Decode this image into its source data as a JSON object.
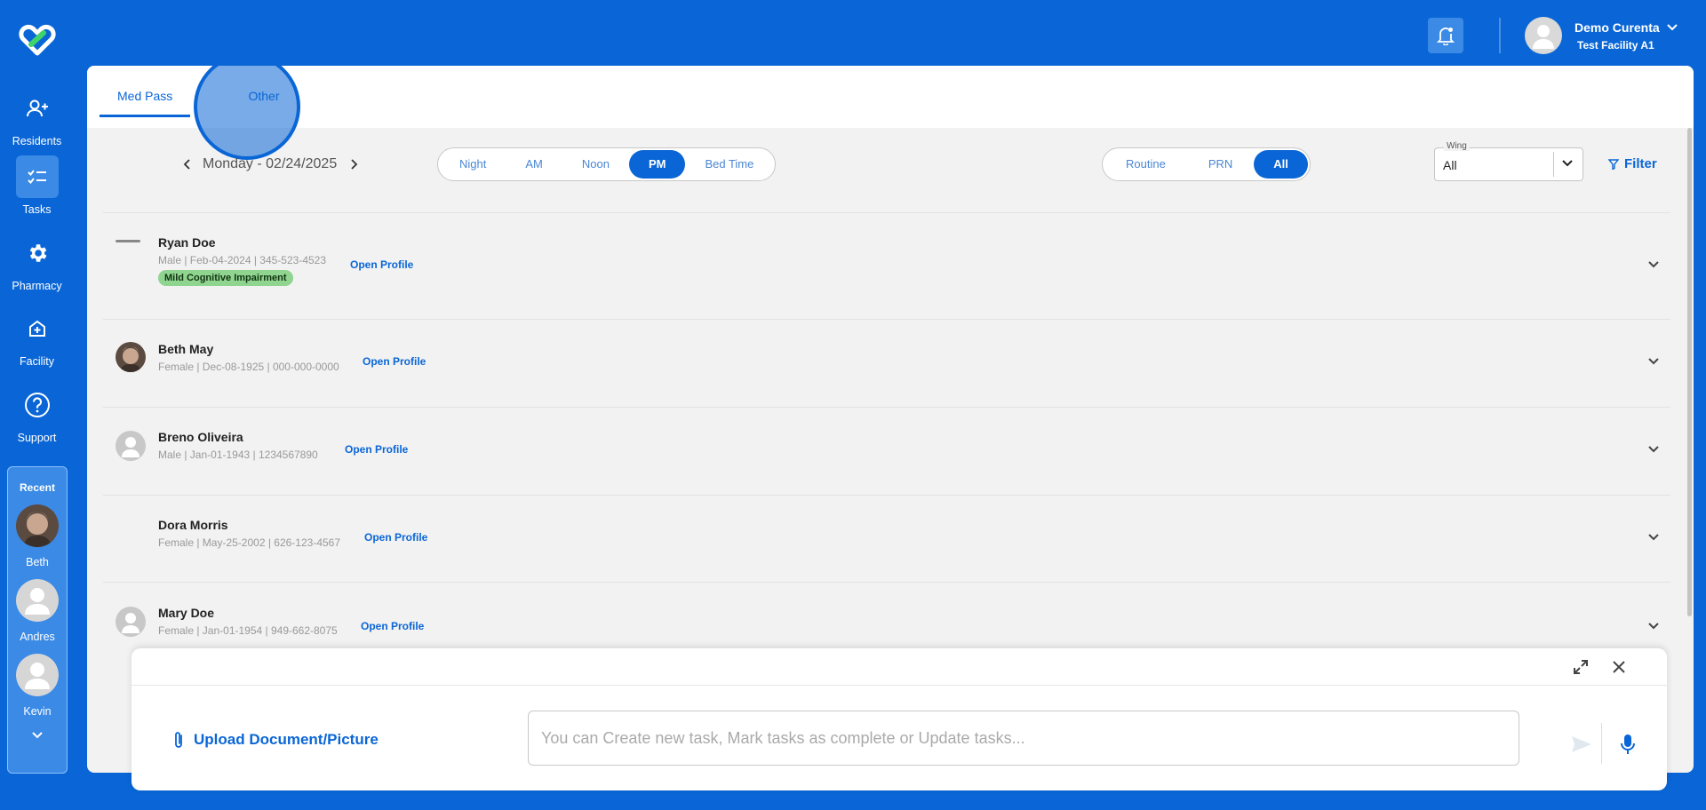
{
  "sidebar": {
    "items": [
      {
        "label": "Residents",
        "icon": "residents-icon"
      },
      {
        "label": "Tasks",
        "icon": "tasks-icon"
      },
      {
        "label": "Pharmacy",
        "icon": "gear-icon"
      },
      {
        "label": "Facility",
        "icon": "facility-icon"
      },
      {
        "label": "Support",
        "icon": "help-icon"
      }
    ],
    "recent": {
      "title": "Recent",
      "people": [
        {
          "name": "Beth"
        },
        {
          "name": "Andres"
        },
        {
          "name": "Kevin"
        }
      ]
    }
  },
  "header": {
    "user_name": "Demo Curenta",
    "facility": "Test Facility A1"
  },
  "tabs": [
    {
      "label": "Med Pass"
    },
    {
      "label": "Other"
    }
  ],
  "date_nav": {
    "date": "Monday - 02/24/2025"
  },
  "times": [
    {
      "label": "Night",
      "selected": false
    },
    {
      "label": "AM",
      "selected": false
    },
    {
      "label": "Noon",
      "selected": false
    },
    {
      "label": "PM",
      "selected": true
    },
    {
      "label": "Bed Time",
      "selected": false
    }
  ],
  "types": [
    {
      "label": "Routine",
      "selected": false
    },
    {
      "label": "PRN",
      "selected": false
    },
    {
      "label": "All",
      "selected": true
    }
  ],
  "wing": {
    "label": "Wing",
    "value": "All"
  },
  "filter_label": "Filter",
  "open_profile_label": "Open Profile",
  "residents": [
    {
      "name": "Ryan Doe",
      "details": "Male | Feb-04-2024 | 345-523-4523",
      "tag": "Mild Cognitive Impairment"
    },
    {
      "name": "Beth May",
      "details": "Female | Dec-08-1925 | 000-000-0000"
    },
    {
      "name": "Breno Oliveira",
      "details": "Male | Jan-01-1943 | 1234567890"
    },
    {
      "name": "Dora Morris",
      "details": "Female | May-25-2002 | 626-123-4567"
    },
    {
      "name": "Mary Doe",
      "details": "Female | Jan-01-1954 | 949-662-8075"
    }
  ],
  "chat": {
    "upload_label": "Upload Document/Picture",
    "placeholder": "You can Create new task, Mark tasks as complete or Update tasks..."
  },
  "colors": {
    "primary": "#0a66d6",
    "tag_bg": "#8fd48f"
  }
}
